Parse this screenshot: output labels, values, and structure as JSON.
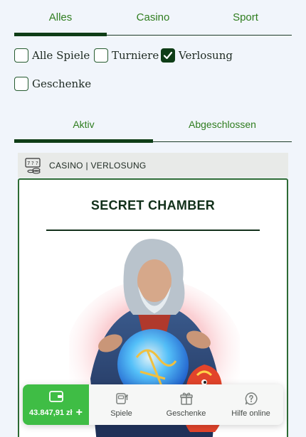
{
  "top_tabs": [
    {
      "label": "Alles",
      "active": true
    },
    {
      "label": "Casino",
      "active": false
    },
    {
      "label": "Sport",
      "active": false
    }
  ],
  "filters": [
    {
      "label": "Alle Spiele",
      "checked": false
    },
    {
      "label": "Turniere",
      "checked": false
    },
    {
      "label": "Verlosung",
      "checked": true
    },
    {
      "label": "Geschenke",
      "checked": false
    }
  ],
  "status_tabs": [
    {
      "label": "Aktiv",
      "active": true
    },
    {
      "label": "Abgeschlossen",
      "active": false
    }
  ],
  "promo": {
    "category_icon": "slot-machine-icon",
    "category": "CASINO | VERLOSUNG",
    "title": "SECRET CHAMBER"
  },
  "bottom_nav": {
    "balance": "43.847,91 zł",
    "items": [
      {
        "label": "Spiele",
        "icon": "slot-icon"
      },
      {
        "label": "Geschenke",
        "icon": "gift-icon"
      },
      {
        "label": "Hilfe online",
        "icon": "help-chat-icon"
      }
    ]
  },
  "colors": {
    "accent_dark": "#0f3d17",
    "tab_text": "#2f7d1f",
    "balance_green": "#3fbd45",
    "background": "#f1f5fb"
  }
}
